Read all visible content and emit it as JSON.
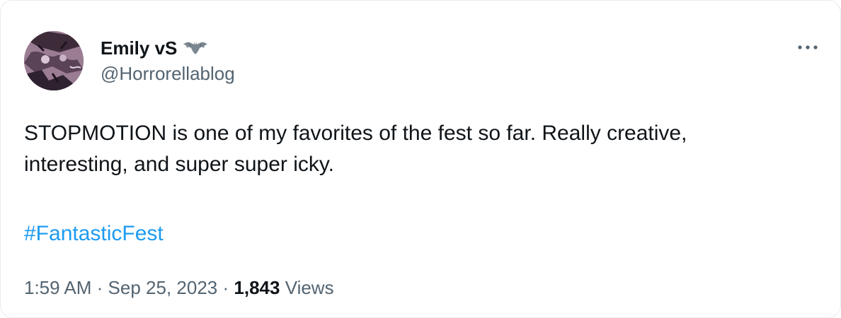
{
  "author": {
    "display_name": "Emily vS",
    "handle": "@Horrorellablog",
    "badge_icon": "bat-icon",
    "avatar_icon": "profile-avatar"
  },
  "tweet": {
    "line1": "STOPMOTION is one of my favorites of the fest so far. Really creative,",
    "line2": "interesting, and super super icky.",
    "hashtag": "#FantasticFest",
    "time": "1:59 AM",
    "separator": "·",
    "date": "Sep 25, 2023",
    "views_count": "1,843",
    "views_label": "Views"
  },
  "actions": {
    "more_icon": "more-horizontal-icon"
  },
  "colors": {
    "text": "#0f1419",
    "secondary": "#536471",
    "link": "#1d9bf0",
    "border": "#e6ecf0"
  }
}
